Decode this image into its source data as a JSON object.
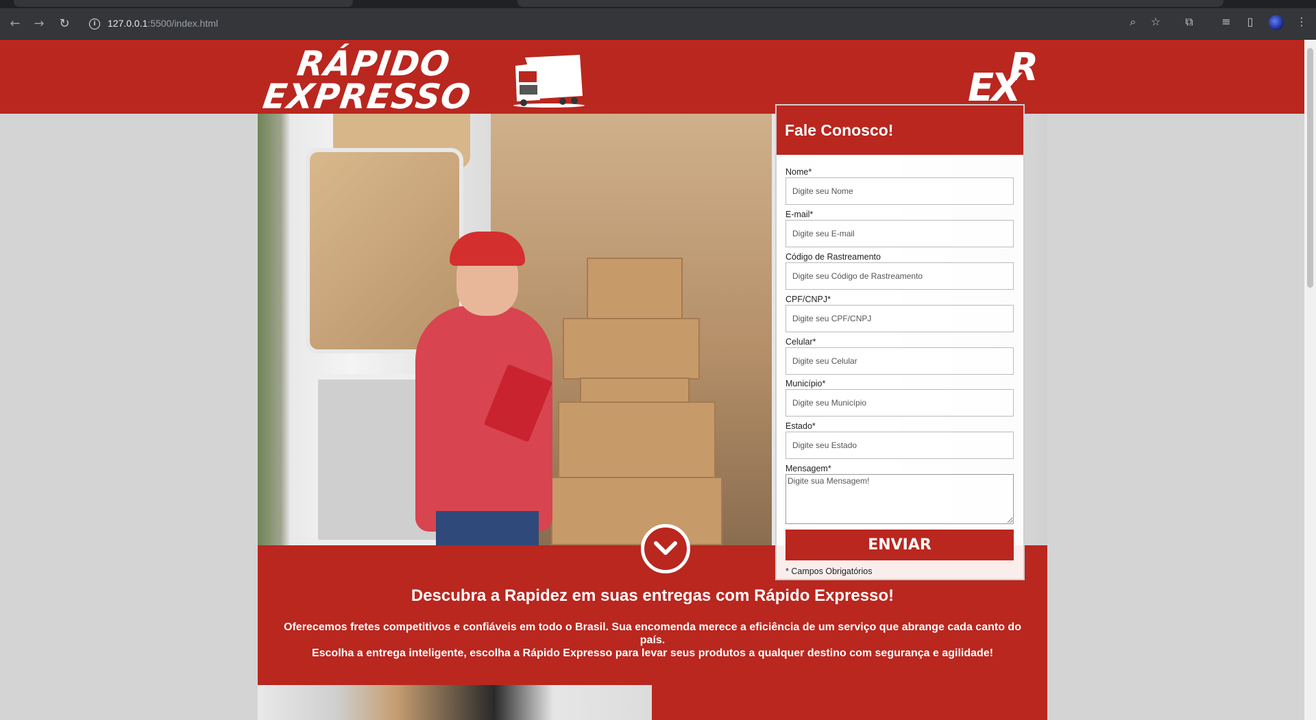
{
  "browser": {
    "url_host": "127.0.0.1",
    "url_path": ":5500/index.html",
    "back_icon": "arrow-left-icon",
    "forward_icon": "arrow-right-icon",
    "reload_icon": "reload-icon"
  },
  "header": {
    "logo_line1": "RÁPIDO",
    "logo_line2": "EXPRESSO",
    "mini_logo_top": "R",
    "mini_logo_bottom": "EX",
    "brand_color": "#b9271f"
  },
  "form": {
    "title": "Fale Conosco!",
    "fields": [
      {
        "label": "Nome*",
        "placeholder": "Digite seu Nome"
      },
      {
        "label": "E-mail*",
        "placeholder": "Digite seu E-mail"
      },
      {
        "label": "Código de Rastreamento",
        "placeholder": "Digite seu Código de Rastreamento"
      },
      {
        "label": "CPF/CNPJ*",
        "placeholder": "Digite seu CPF/CNPJ"
      },
      {
        "label": "Celular*",
        "placeholder": "Digite seu Celular"
      },
      {
        "label": "Município*",
        "placeholder": "Digite seu Município"
      },
      {
        "label": "Estado*",
        "placeholder": "Digite seu Estado"
      }
    ],
    "message": {
      "label": "Mensagem*",
      "placeholder": "Digite sua Mensagem!"
    },
    "submit_label": "ENVIAR",
    "required_note": "* Campos Obrigatórios"
  },
  "band": {
    "title": "Descubra a Rapidez em suas entregas com Rápido Expresso!",
    "text_line1": "Oferecemos fretes competitivos e confiáveis em todo o Brasil. Sua encomenda merece a eficiência de um serviço que abrange cada canto do país.",
    "text_line2": "Escolha a entrega inteligente, escolha a Rápido Expresso para levar seus produtos a qualquer destino com segurança e agilidade!"
  }
}
